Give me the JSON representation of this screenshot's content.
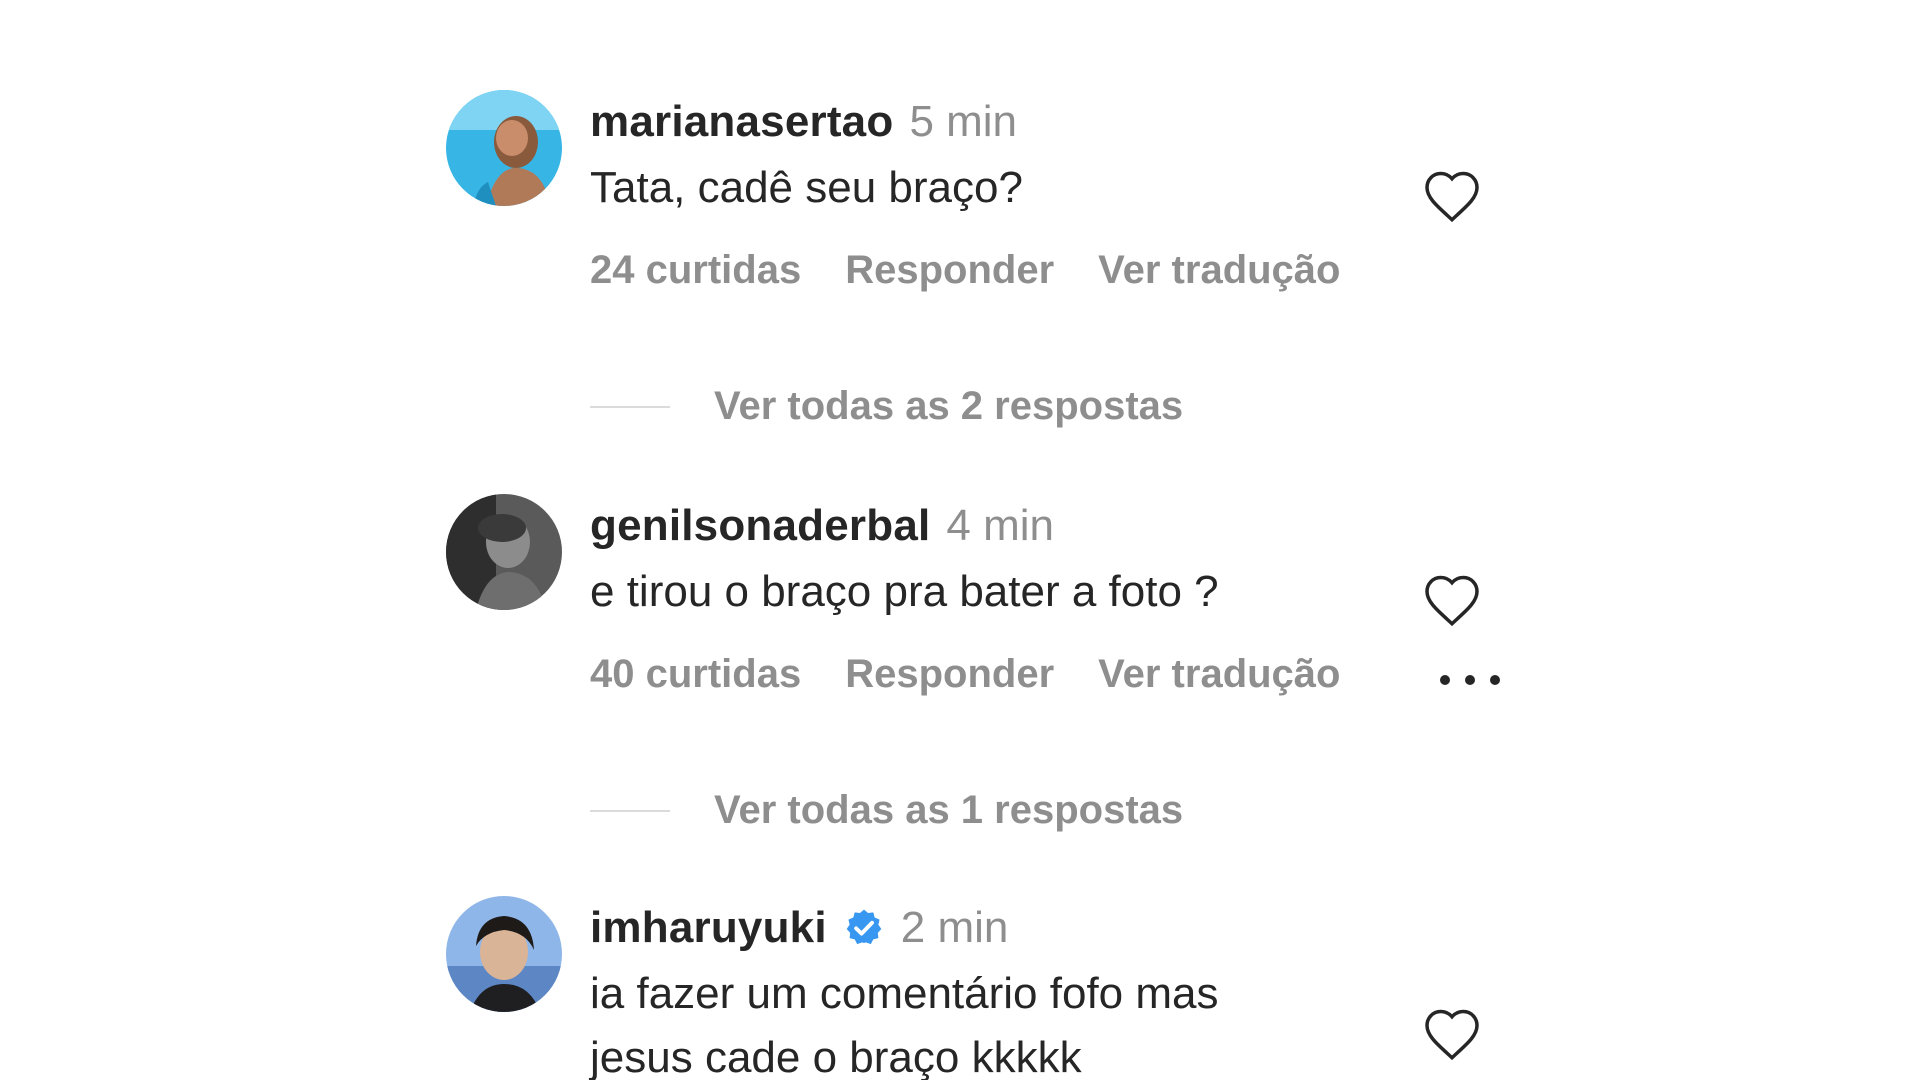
{
  "colors": {
    "text_primary": "#262626",
    "text_secondary": "#8e8e8e",
    "verified_blue": "#3897f0",
    "divider": "#dbdbdb"
  },
  "comments": [
    {
      "username": "marianasertao",
      "time": "5 min",
      "text": "Tata, cadê seu braço?",
      "likes": "24 curtidas",
      "reply_label": "Responder",
      "translate_label": "Ver tradução",
      "verified": false,
      "icons": [
        "heart-icon"
      ]
    },
    {
      "username": "genilsonaderbal",
      "time": "4 min",
      "text": "e tirou o braço pra bater a foto ?",
      "likes": "40 curtidas",
      "reply_label": "Responder",
      "translate_label": "Ver tradução",
      "verified": false,
      "icons": [
        "heart-icon",
        "more-options-icon"
      ]
    },
    {
      "username": "imharuyuki",
      "time": "2 min",
      "text": "ia fazer um comentário fofo mas\njesus cade o braço kkkkk",
      "verified": true,
      "icons": [
        "verified-badge-icon",
        "heart-icon"
      ]
    }
  ],
  "view_replies": [
    "Ver todas as 2 respostas",
    "Ver todas as 1 respostas"
  ]
}
